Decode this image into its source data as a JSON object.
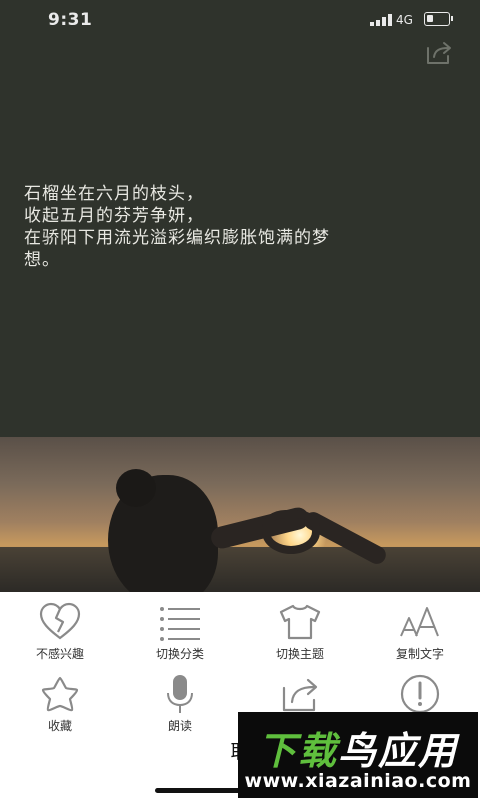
{
  "status_bar": {
    "time": "9:31",
    "network": "4G",
    "battery_level": 0.3
  },
  "reader": {
    "share_icon": "share-icon",
    "poem_lines": [
      " 石榴坐在六月的枝头，",
      "收起五月的芬芳争妍，",
      "在骄阳下用流光溢彩编织膨胀饱满的梦",
      "想。"
    ]
  },
  "actions": [
    {
      "label": "不感兴趣",
      "icon": "broken-heart-icon"
    },
    {
      "label": "切换分类",
      "icon": "list-icon"
    },
    {
      "label": "切换主题",
      "icon": "tshirt-icon"
    },
    {
      "label": "复制文字",
      "icon": "font-size-icon"
    },
    {
      "label": "收藏",
      "icon": "star-icon"
    },
    {
      "label": "朗读",
      "icon": "microphone-icon"
    },
    {
      "label": "",
      "icon": "share-icon"
    },
    {
      "label": "",
      "icon": "report-icon"
    }
  ],
  "cancel_label": "取",
  "watermark": {
    "title_part1": "下载",
    "title_part2": "鸟",
    "title_part3": "应用",
    "url": "www.xiazainiao.com"
  },
  "colors": {
    "reader_bg": "#2f332c",
    "icon_gray": "#8a8a8a",
    "watermark_green": "#5fbf3d"
  }
}
